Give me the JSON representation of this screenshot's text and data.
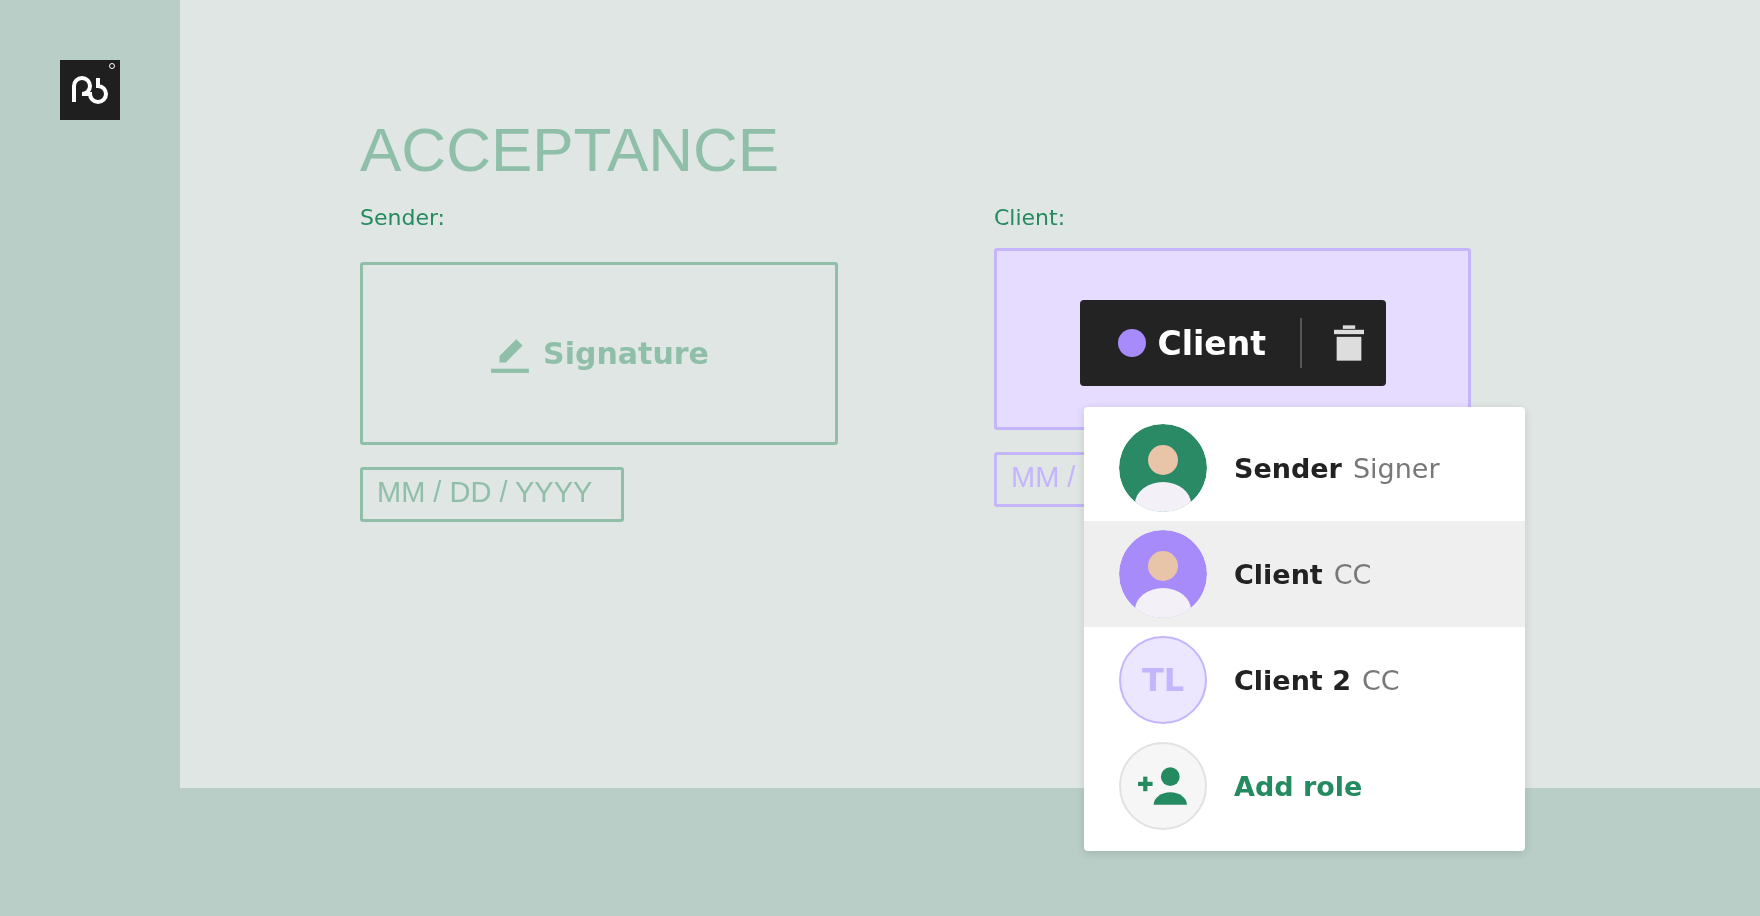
{
  "heading": "ACCEPTANCE",
  "sender": {
    "label": "Sender:",
    "signature": "Signature",
    "date_placeholder": "MM / DD / YYYY"
  },
  "client": {
    "label": "Client:",
    "date_placeholder": "MM /",
    "chip": {
      "label": "Client",
      "color": "#a78bfa"
    }
  },
  "roles": [
    {
      "kind": "photo",
      "name": "Sender",
      "role": "Signer",
      "selected": false,
      "color": "#2a8a66"
    },
    {
      "kind": "photo",
      "name": "Client",
      "role": "CC",
      "selected": true,
      "color": "#a78bfa"
    },
    {
      "kind": "initials",
      "initials": "TL",
      "name": "Client 2",
      "role": "CC",
      "selected": false
    },
    {
      "kind": "add",
      "name": "Add role",
      "selected": false
    }
  ]
}
